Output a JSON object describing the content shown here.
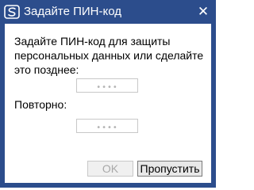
{
  "window": {
    "title": "Задайте ПИН-код",
    "close_glyph": "✕",
    "icon": "app-s-logo-icon",
    "title_bar_color": "#2c4d8c"
  },
  "content": {
    "prompt": "Задайте ПИН-код для защиты персональных данных или сделайте это позднее:",
    "pin_placeholder": "••••",
    "repeat_label": "Повторно:",
    "repeat_placeholder": "••••",
    "pin_value": "",
    "repeat_value": ""
  },
  "buttons": {
    "ok_label": "OK",
    "ok_enabled": false,
    "skip_label": "Пропустить"
  }
}
